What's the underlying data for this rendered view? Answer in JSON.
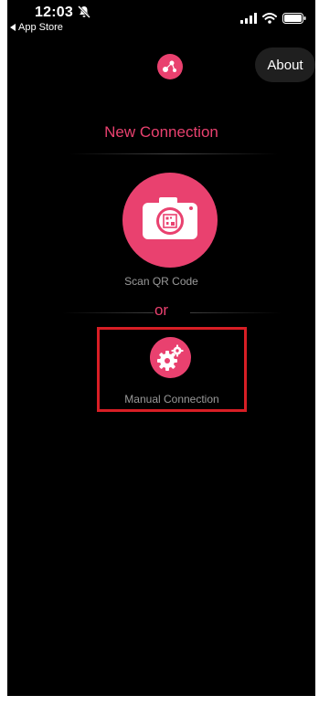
{
  "status_bar": {
    "time": "12:03",
    "back_app": "App Store"
  },
  "header": {
    "about_label": "About"
  },
  "main": {
    "heading": "New Connection",
    "scan_label": "Scan QR Code",
    "or_label": "or",
    "manual_label": "Manual Connection"
  },
  "colors": {
    "accent": "#e9416f",
    "highlight_border": "#d81e25",
    "background": "#000000",
    "label_gray": "#9a9a9a"
  },
  "icons": {
    "logo": "app-logo-icon",
    "scan": "camera-icon",
    "manual": "gears-icon"
  }
}
